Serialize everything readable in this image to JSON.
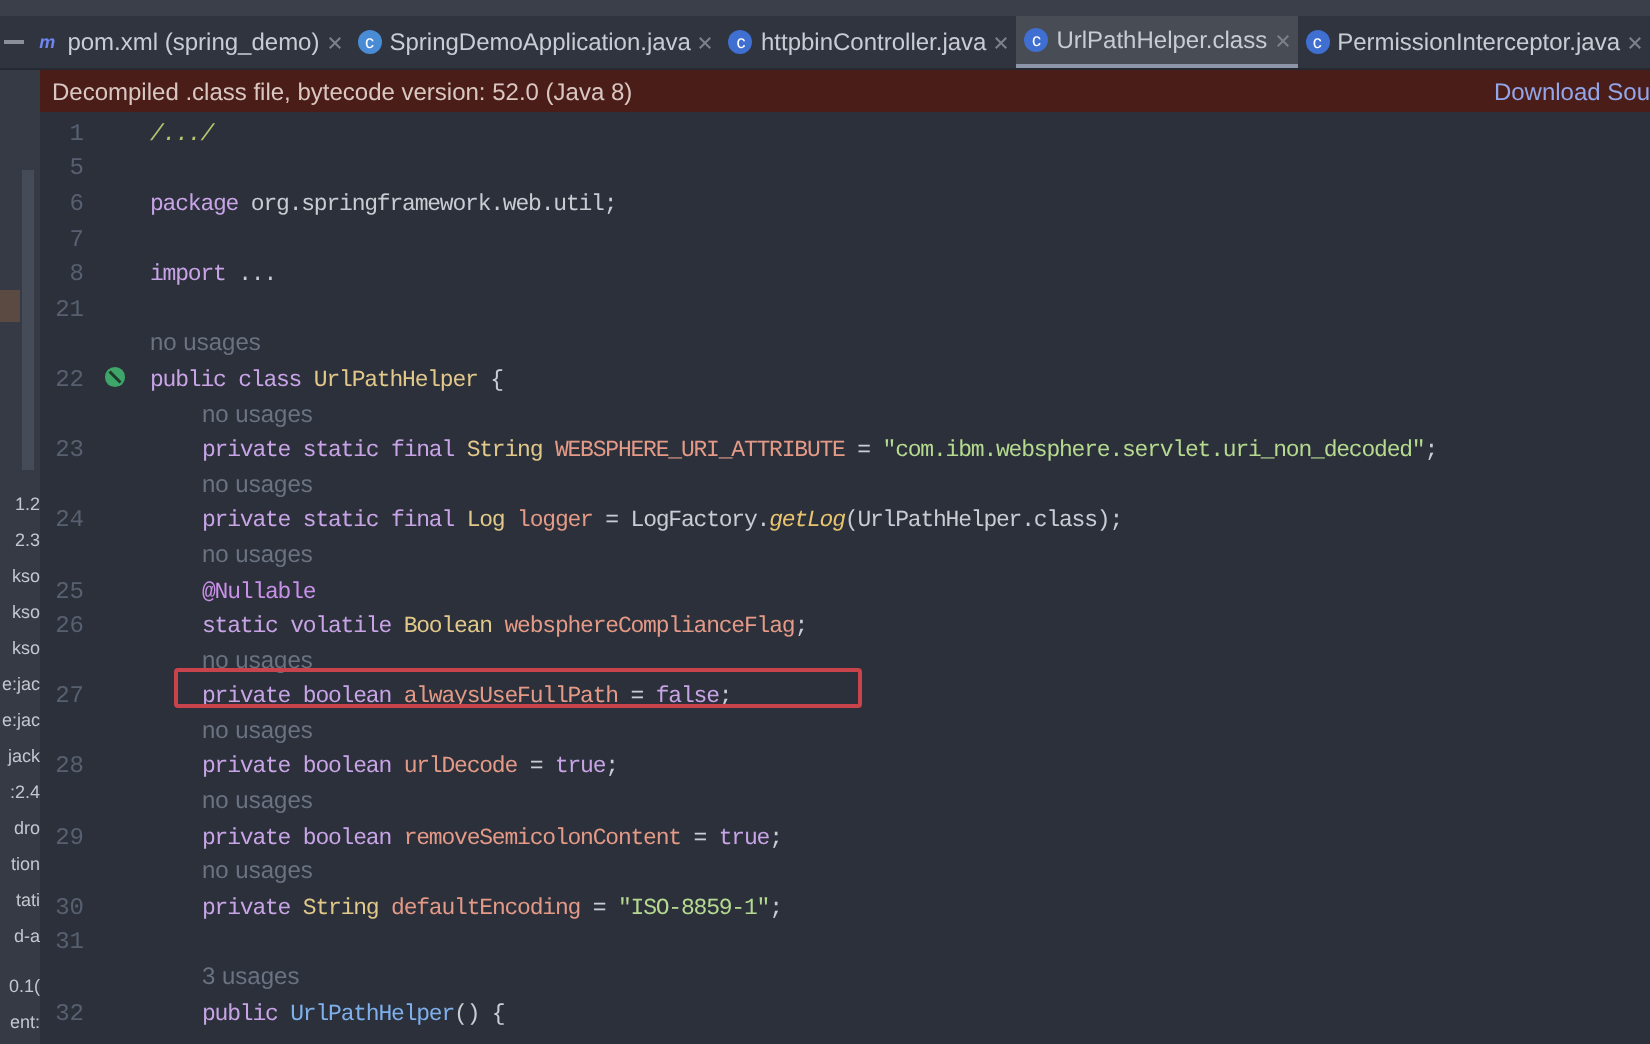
{
  "tabs": [
    {
      "label": "pom.xml (spring_demo)",
      "icon_text": "m",
      "selected": false
    },
    {
      "label": "SpringDemoApplication.java",
      "icon_text": "c",
      "selected": false
    },
    {
      "label": "httpbinController.java",
      "icon_text": "c",
      "selected": false
    },
    {
      "label": "UrlPathHelper.class",
      "icon_text": "c",
      "selected": true
    },
    {
      "label": "PermissionInterceptor.java",
      "icon_text": "c",
      "selected": false
    }
  ],
  "banner": {
    "text": "Decompiled .class file, bytecode version: 52.0 (Java 8)",
    "link": "Download Sou"
  },
  "project_tree": [
    "1.2",
    "2.3",
    "kso",
    "kso",
    "kso",
    "e:jac",
    "e:jac",
    "jack",
    ":2.4",
    "dro",
    "tion",
    "tati",
    "d-a",
    "0.1(",
    "ent:"
  ],
  "editor": {
    "lines": [
      {
        "kind": "code",
        "number": "1",
        "tokens": [
          {
            "text": "/.../",
            "kind": "folded"
          }
        ]
      },
      {
        "kind": "code",
        "number": "5"
      },
      {
        "kind": "code",
        "number": "6",
        "tokens": [
          {
            "text": "package",
            "kind": "kw"
          },
          {
            "text": " org.springframework.web.util;",
            "kind": "plain"
          }
        ]
      },
      {
        "kind": "code",
        "number": "7"
      },
      {
        "kind": "code",
        "number": "8",
        "tokens": [
          {
            "text": "import",
            "kind": "kw"
          },
          {
            "text": " ...",
            "kind": "plain"
          }
        ]
      },
      {
        "kind": "code",
        "number": "21"
      },
      {
        "kind": "hint",
        "text": "no usages"
      },
      {
        "kind": "code",
        "number": "22",
        "marker": true,
        "tokens": [
          {
            "text": "public class ",
            "kind": "kw"
          },
          {
            "text": "UrlPathHelper",
            "kind": "cls"
          },
          {
            "text": " {",
            "kind": "plain"
          }
        ],
        "children": [
          {
            "kind": "hint",
            "text": "no usages"
          },
          {
            "kind": "code",
            "number": "23",
            "tokens": [
              {
                "text": "private static final ",
                "kind": "kw"
              },
              {
                "text": "String ",
                "kind": "type"
              },
              {
                "text": "WEBSPHERE_URI_ATTRIBUTE",
                "kind": "field"
              },
              {
                "text": " = ",
                "kind": "plain"
              },
              {
                "text": "\"com.ibm.websphere.servlet.uri_non_decoded\"",
                "kind": "str"
              },
              {
                "text": ";",
                "kind": "plain"
              }
            ]
          },
          {
            "kind": "hint",
            "text": "no usages"
          },
          {
            "kind": "code",
            "number": "24",
            "tokens": [
              {
                "text": "private static final ",
                "kind": "kw"
              },
              {
                "text": "Log ",
                "kind": "type"
              },
              {
                "text": "logger",
                "kind": "field"
              },
              {
                "text": " = LogFactory.",
                "kind": "plain"
              },
              {
                "text": "getLog",
                "kind": "method"
              },
              {
                "text": "(UrlPathHelper.class);",
                "kind": "plain"
              }
            ]
          },
          {
            "kind": "hint",
            "text": "no usages"
          },
          {
            "kind": "code",
            "number": "25",
            "tokens": [
              {
                "text": "@Nullable",
                "kind": "ann"
              }
            ]
          },
          {
            "kind": "code",
            "number": "26",
            "tokens": [
              {
                "text": "static volatile ",
                "kind": "kw"
              },
              {
                "text": "Boolean ",
                "kind": "type"
              },
              {
                "text": "websphereComplianceFlag",
                "kind": "field"
              },
              {
                "text": ";",
                "kind": "plain"
              }
            ]
          },
          {
            "kind": "hint",
            "text": "no usages"
          },
          {
            "kind": "code",
            "number": "27",
            "highlighted": true,
            "tokens": [
              {
                "text": "private boolean ",
                "kind": "kw"
              },
              {
                "text": "alwaysUseFullPath",
                "kind": "field"
              },
              {
                "text": " = ",
                "kind": "plain"
              },
              {
                "text": "false",
                "kind": "kw"
              },
              {
                "text": ";",
                "kind": "plain"
              }
            ]
          },
          {
            "kind": "hint",
            "text": "no usages"
          },
          {
            "kind": "code",
            "number": "28",
            "tokens": [
              {
                "text": "private boolean ",
                "kind": "kw"
              },
              {
                "text": "urlDecode",
                "kind": "field"
              },
              {
                "text": " = ",
                "kind": "plain"
              },
              {
                "text": "true",
                "kind": "kw"
              },
              {
                "text": ";",
                "kind": "plain"
              }
            ]
          },
          {
            "kind": "hint",
            "text": "no usages"
          },
          {
            "kind": "code",
            "number": "29",
            "tokens": [
              {
                "text": "private boolean ",
                "kind": "kw"
              },
              {
                "text": "removeSemicolonContent",
                "kind": "field"
              },
              {
                "text": " = ",
                "kind": "plain"
              },
              {
                "text": "true",
                "kind": "kw"
              },
              {
                "text": ";",
                "kind": "plain"
              }
            ]
          },
          {
            "kind": "hint",
            "text": "no usages"
          },
          {
            "kind": "code",
            "number": "30",
            "tokens": [
              {
                "text": "private ",
                "kind": "kw"
              },
              {
                "text": "String ",
                "kind": "type"
              },
              {
                "text": "defaultEncoding",
                "kind": "field"
              },
              {
                "text": " = ",
                "kind": "plain"
              },
              {
                "text": "\"ISO-8859-1\"",
                "kind": "str"
              },
              {
                "text": ";",
                "kind": "plain"
              }
            ]
          },
          {
            "kind": "code",
            "number": "31"
          },
          {
            "kind": "hint",
            "text": "3 usages"
          },
          {
            "kind": "code",
            "number": "32",
            "tokens": [
              {
                "text": "public ",
                "kind": "kw"
              },
              {
                "text": "UrlPathHelper",
                "kind": "ctor"
              },
              {
                "text": "() {",
                "kind": "plain"
              }
            ]
          }
        ]
      }
    ]
  }
}
